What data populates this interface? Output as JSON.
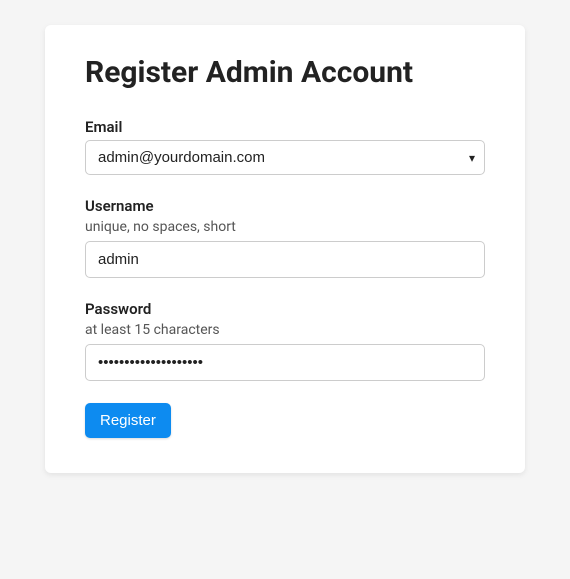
{
  "title": "Register Admin Account",
  "email": {
    "label": "Email",
    "selected": "admin@yourdomain.com"
  },
  "username": {
    "label": "Username",
    "hint": "unique, no spaces, short",
    "value": "admin"
  },
  "password": {
    "label": "Password",
    "hint": "at least 15 characters",
    "value": "••••••••••••••••••••"
  },
  "submit": {
    "label": "Register"
  }
}
